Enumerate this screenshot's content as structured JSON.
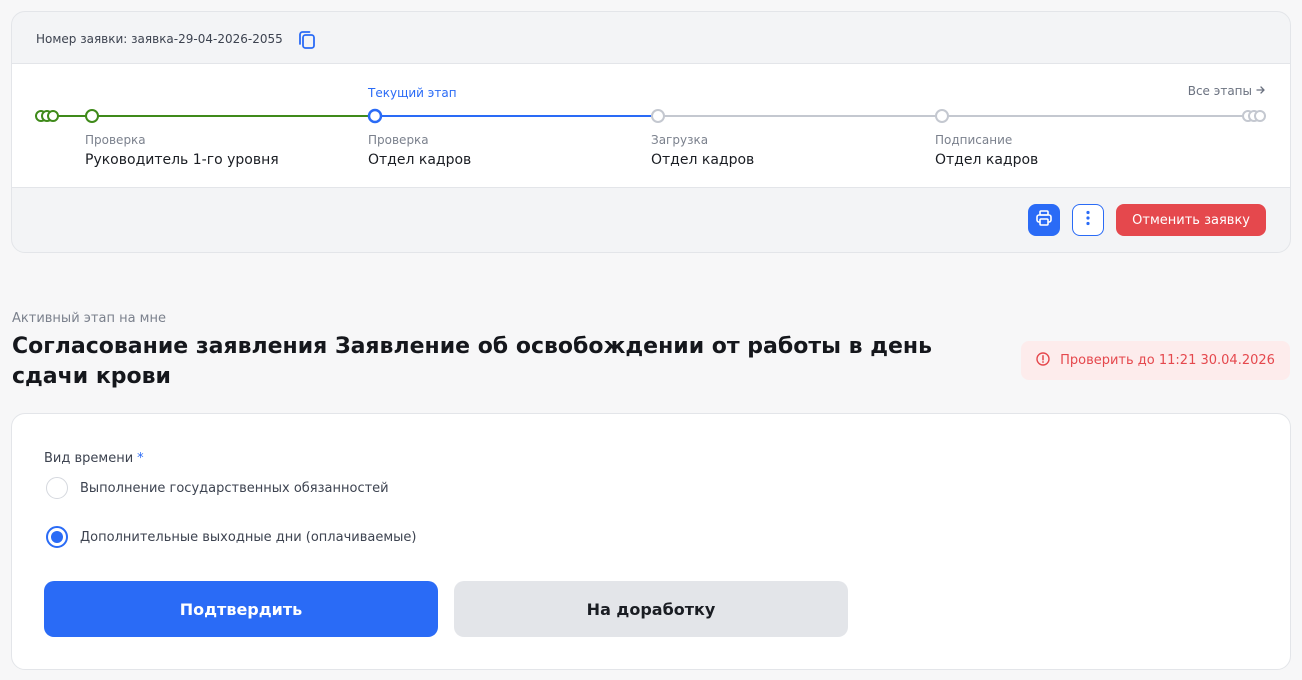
{
  "request": {
    "number_text": "Номер заявки: заявка-29-04-2026-2055"
  },
  "stages": {
    "current_label": "Текущий этап",
    "all_stages_label": "Все этапы",
    "items": [
      {
        "kind": "Проверка",
        "name": "Руководитель 1-го уровня",
        "status": "done"
      },
      {
        "kind": "Проверка",
        "name": "Отдел кадров",
        "status": "current"
      },
      {
        "kind": "Загрузка",
        "name": "Отдел кадров",
        "status": "pending"
      },
      {
        "kind": "Подписание",
        "name": "Отдел кадров",
        "status": "pending"
      }
    ]
  },
  "actions": {
    "print_icon": "printer-icon",
    "more_icon": "more-vertical-icon",
    "cancel_label": "Отменить заявку"
  },
  "active_stage": {
    "label": "Активный этап на мне",
    "title": "Согласование заявления Заявление об освобождении от работы в день сдачи крови",
    "deadline": "Проверить до 11:21 30.04.2026"
  },
  "form": {
    "field_label": "Вид времени",
    "required_mark": "*",
    "options": [
      {
        "label": "Выполнение государственных обязанностей",
        "checked": false
      },
      {
        "label": "Дополнительные выходные дни (оплачиваемые)",
        "checked": true
      }
    ],
    "confirm_label": "Подтвердить",
    "rework_label": "На доработку"
  },
  "colors": {
    "accent": "#2a6bf6",
    "done": "#3f8a1a",
    "pending": "#c4c8d0",
    "danger": "#e5484d",
    "danger_bg": "#fdecec"
  }
}
